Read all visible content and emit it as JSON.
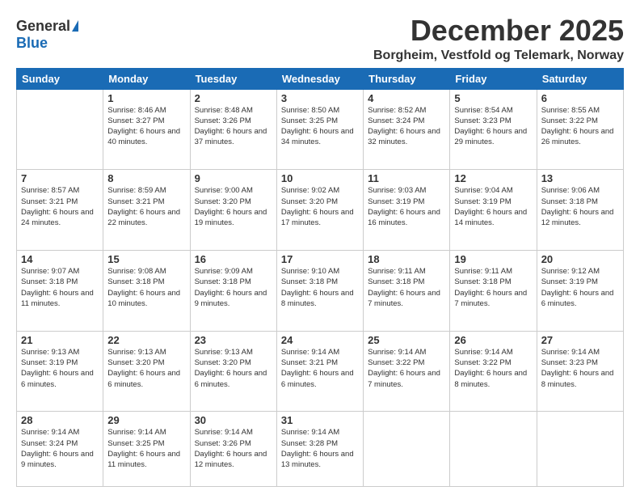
{
  "logo": {
    "general": "General",
    "blue": "Blue"
  },
  "header": {
    "month": "December 2025",
    "location": "Borgheim, Vestfold og Telemark, Norway"
  },
  "weekdays": [
    "Sunday",
    "Monday",
    "Tuesday",
    "Wednesday",
    "Thursday",
    "Friday",
    "Saturday"
  ],
  "weeks": [
    [
      {
        "day": "",
        "sunrise": "",
        "sunset": "",
        "daylight": ""
      },
      {
        "day": "1",
        "sunrise": "Sunrise: 8:46 AM",
        "sunset": "Sunset: 3:27 PM",
        "daylight": "Daylight: 6 hours and 40 minutes."
      },
      {
        "day": "2",
        "sunrise": "Sunrise: 8:48 AM",
        "sunset": "Sunset: 3:26 PM",
        "daylight": "Daylight: 6 hours and 37 minutes."
      },
      {
        "day": "3",
        "sunrise": "Sunrise: 8:50 AM",
        "sunset": "Sunset: 3:25 PM",
        "daylight": "Daylight: 6 hours and 34 minutes."
      },
      {
        "day": "4",
        "sunrise": "Sunrise: 8:52 AM",
        "sunset": "Sunset: 3:24 PM",
        "daylight": "Daylight: 6 hours and 32 minutes."
      },
      {
        "day": "5",
        "sunrise": "Sunrise: 8:54 AM",
        "sunset": "Sunset: 3:23 PM",
        "daylight": "Daylight: 6 hours and 29 minutes."
      },
      {
        "day": "6",
        "sunrise": "Sunrise: 8:55 AM",
        "sunset": "Sunset: 3:22 PM",
        "daylight": "Daylight: 6 hours and 26 minutes."
      }
    ],
    [
      {
        "day": "7",
        "sunrise": "Sunrise: 8:57 AM",
        "sunset": "Sunset: 3:21 PM",
        "daylight": "Daylight: 6 hours and 24 minutes."
      },
      {
        "day": "8",
        "sunrise": "Sunrise: 8:59 AM",
        "sunset": "Sunset: 3:21 PM",
        "daylight": "Daylight: 6 hours and 22 minutes."
      },
      {
        "day": "9",
        "sunrise": "Sunrise: 9:00 AM",
        "sunset": "Sunset: 3:20 PM",
        "daylight": "Daylight: 6 hours and 19 minutes."
      },
      {
        "day": "10",
        "sunrise": "Sunrise: 9:02 AM",
        "sunset": "Sunset: 3:20 PM",
        "daylight": "Daylight: 6 hours and 17 minutes."
      },
      {
        "day": "11",
        "sunrise": "Sunrise: 9:03 AM",
        "sunset": "Sunset: 3:19 PM",
        "daylight": "Daylight: 6 hours and 16 minutes."
      },
      {
        "day": "12",
        "sunrise": "Sunrise: 9:04 AM",
        "sunset": "Sunset: 3:19 PM",
        "daylight": "Daylight: 6 hours and 14 minutes."
      },
      {
        "day": "13",
        "sunrise": "Sunrise: 9:06 AM",
        "sunset": "Sunset: 3:18 PM",
        "daylight": "Daylight: 6 hours and 12 minutes."
      }
    ],
    [
      {
        "day": "14",
        "sunrise": "Sunrise: 9:07 AM",
        "sunset": "Sunset: 3:18 PM",
        "daylight": "Daylight: 6 hours and 11 minutes."
      },
      {
        "day": "15",
        "sunrise": "Sunrise: 9:08 AM",
        "sunset": "Sunset: 3:18 PM",
        "daylight": "Daylight: 6 hours and 10 minutes."
      },
      {
        "day": "16",
        "sunrise": "Sunrise: 9:09 AM",
        "sunset": "Sunset: 3:18 PM",
        "daylight": "Daylight: 6 hours and 9 minutes."
      },
      {
        "day": "17",
        "sunrise": "Sunrise: 9:10 AM",
        "sunset": "Sunset: 3:18 PM",
        "daylight": "Daylight: 6 hours and 8 minutes."
      },
      {
        "day": "18",
        "sunrise": "Sunrise: 9:11 AM",
        "sunset": "Sunset: 3:18 PM",
        "daylight": "Daylight: 6 hours and 7 minutes."
      },
      {
        "day": "19",
        "sunrise": "Sunrise: 9:11 AM",
        "sunset": "Sunset: 3:18 PM",
        "daylight": "Daylight: 6 hours and 7 minutes."
      },
      {
        "day": "20",
        "sunrise": "Sunrise: 9:12 AM",
        "sunset": "Sunset: 3:19 PM",
        "daylight": "Daylight: 6 hours and 6 minutes."
      }
    ],
    [
      {
        "day": "21",
        "sunrise": "Sunrise: 9:13 AM",
        "sunset": "Sunset: 3:19 PM",
        "daylight": "Daylight: 6 hours and 6 minutes."
      },
      {
        "day": "22",
        "sunrise": "Sunrise: 9:13 AM",
        "sunset": "Sunset: 3:20 PM",
        "daylight": "Daylight: 6 hours and 6 minutes."
      },
      {
        "day": "23",
        "sunrise": "Sunrise: 9:13 AM",
        "sunset": "Sunset: 3:20 PM",
        "daylight": "Daylight: 6 hours and 6 minutes."
      },
      {
        "day": "24",
        "sunrise": "Sunrise: 9:14 AM",
        "sunset": "Sunset: 3:21 PM",
        "daylight": "Daylight: 6 hours and 6 minutes."
      },
      {
        "day": "25",
        "sunrise": "Sunrise: 9:14 AM",
        "sunset": "Sunset: 3:22 PM",
        "daylight": "Daylight: 6 hours and 7 minutes."
      },
      {
        "day": "26",
        "sunrise": "Sunrise: 9:14 AM",
        "sunset": "Sunset: 3:22 PM",
        "daylight": "Daylight: 6 hours and 8 minutes."
      },
      {
        "day": "27",
        "sunrise": "Sunrise: 9:14 AM",
        "sunset": "Sunset: 3:23 PM",
        "daylight": "Daylight: 6 hours and 8 minutes."
      }
    ],
    [
      {
        "day": "28",
        "sunrise": "Sunrise: 9:14 AM",
        "sunset": "Sunset: 3:24 PM",
        "daylight": "Daylight: 6 hours and 9 minutes."
      },
      {
        "day": "29",
        "sunrise": "Sunrise: 9:14 AM",
        "sunset": "Sunset: 3:25 PM",
        "daylight": "Daylight: 6 hours and 11 minutes."
      },
      {
        "day": "30",
        "sunrise": "Sunrise: 9:14 AM",
        "sunset": "Sunset: 3:26 PM",
        "daylight": "Daylight: 6 hours and 12 minutes."
      },
      {
        "day": "31",
        "sunrise": "Sunrise: 9:14 AM",
        "sunset": "Sunset: 3:28 PM",
        "daylight": "Daylight: 6 hours and 13 minutes."
      },
      {
        "day": "",
        "sunrise": "",
        "sunset": "",
        "daylight": ""
      },
      {
        "day": "",
        "sunrise": "",
        "sunset": "",
        "daylight": ""
      },
      {
        "day": "",
        "sunrise": "",
        "sunset": "",
        "daylight": ""
      }
    ]
  ]
}
